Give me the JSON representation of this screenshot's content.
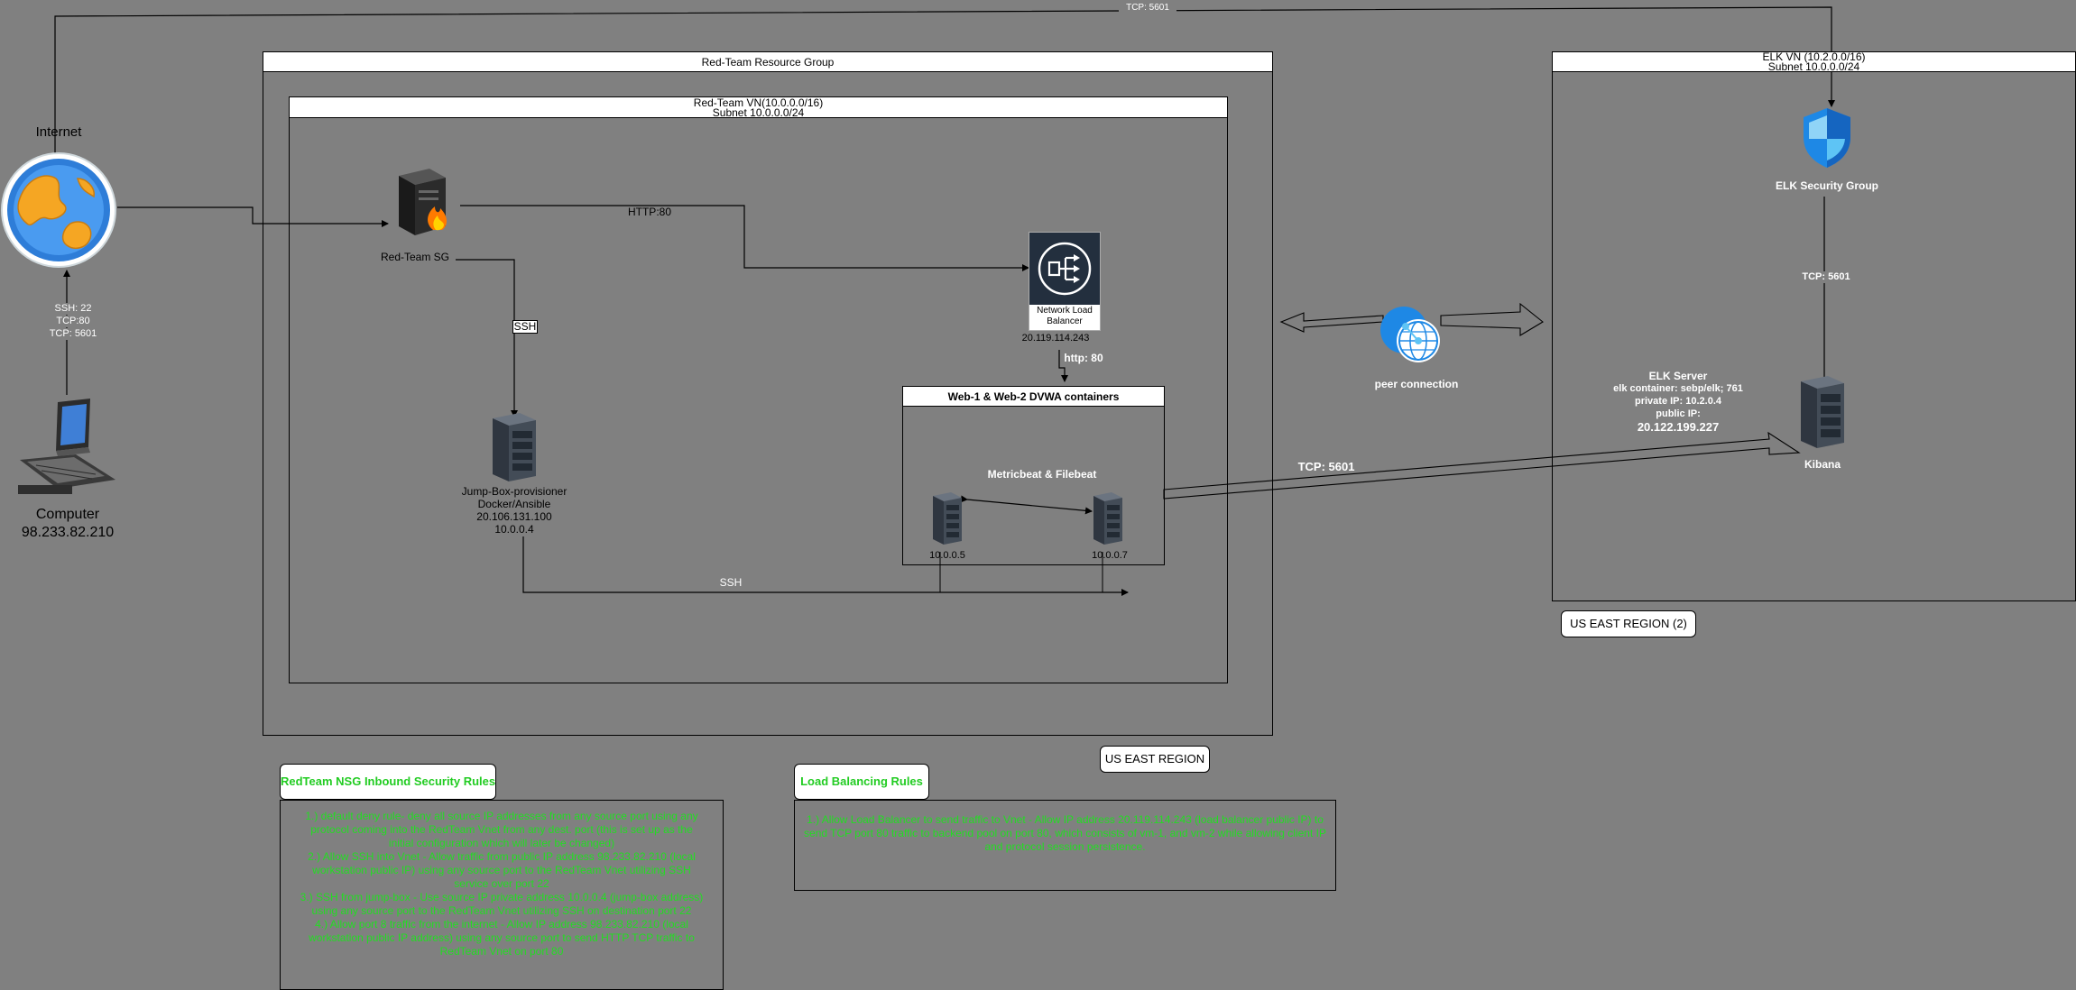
{
  "internet": {
    "label": "Internet"
  },
  "computer": {
    "label": "Computer",
    "ip": "98.233.82.210"
  },
  "computer_ports": [
    "SSH: 22",
    "TCP:80",
    "TCP: 5601"
  ],
  "top_link": {
    "label": "TCP: 5601"
  },
  "resource_group": {
    "title": "Red-Team Resource Group"
  },
  "vnet": {
    "title_line1": "Red-Team VN(10.0.0.0/16)",
    "title_line2": "Subnet 10.0.0.0/24"
  },
  "redteam_sg": {
    "label": "Red-Team SG"
  },
  "http_link": {
    "label": "HTTP:80"
  },
  "ssh_link_vertical": {
    "label": "SSH"
  },
  "load_balancer": {
    "line1": "Network Load",
    "line2": "Balancer",
    "ip": "20.119.114.243"
  },
  "http_lb_link": {
    "label": "http: 80"
  },
  "jump_box": {
    "line1": "Jump-Box-provisioner",
    "line2": "Docker/Ansible",
    "line3": "20.106.131.100",
    "line4": "10.0.0.4"
  },
  "web_containers": {
    "title": "Web-1 & Web-2 DVWA containers",
    "beats": "Metricbeat & Filebeat",
    "web1_ip": "10.0.0.5",
    "web2_ip": "10.0.0.7"
  },
  "ssh_link_bottom": {
    "label": "SSH"
  },
  "peer": {
    "label": "peer connection"
  },
  "tcp_elk_link": {
    "label": "TCP: 5601"
  },
  "elk_vnet": {
    "title_line1": "ELK VN (10.2.0.0/16)",
    "title_line2": "Subnet 10.0.0.0/24"
  },
  "elk_sg": {
    "label": "ELK Security Group"
  },
  "elk_sg_link": {
    "label": "TCP: 5601"
  },
  "elk_server": {
    "line1": "ELK Server",
    "line2": "elk container: sebp/elk; 761",
    "line3": "private IP: 10.2.0.4",
    "line4": "public IP:",
    "line5": "20.122.199.227",
    "kibana": "Kibana"
  },
  "region_east2": {
    "label": "US EAST REGION (2)"
  },
  "region_east": {
    "label": "US EAST REGION"
  },
  "nsg_rules": {
    "title": "RedTeam NSG Inbound Security Rules",
    "rules": [
      "1.) default deny rule- deny all source IP addresses from any source port using any protocol coming into the RedTeam Vnet from any dest. port (this is set up as the initial configuration which will later be changed)",
      "2.) Allow SSH into Vnet - Allow traffic from public IP address 98.233.82.210 (local workstation public IP) using any source port to the RedTeam Vnet utilizing SSH service over port 22",
      "3.) SSH from jump-box - Use source IP private address 10.0.0.4 (jump-box address) using any source port to the RedTeam Vnet utilizing SSH on destination port 22",
      "4.) Allow port 8 traffic from the internet - Allow IP address 98.233.82.210 (local workstation public IP address) using any source port to send HTTP TCP traffic to RedTeam Vnet on port 80"
    ]
  },
  "lb_rules": {
    "title": "Load Balancing Rules",
    "rules": [
      "1.) Allow Load Balancer to send traffic to Vnet - Allow IP address 20.119.114.243 (load balancer public IP) to send TCP port 80 traffic to backend pool on port 80, which consists of vm-1, and vm-2 while allowing client IP and protocol session persistence."
    ]
  },
  "colors": {
    "background": "#808080",
    "rule_text": "#22dd22",
    "azure_blue": "#1e88e5",
    "lb_dark": "#232f3e"
  }
}
